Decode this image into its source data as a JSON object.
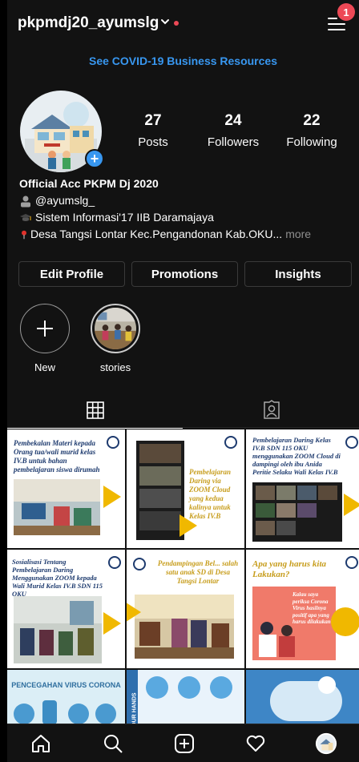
{
  "header": {
    "username": "pkpmdj20_ayumslg",
    "notification_count": "1"
  },
  "banner": {
    "covid_link": "See COVID-19 Business Resources"
  },
  "profile": {
    "stats": [
      {
        "value": "27",
        "label": "Posts"
      },
      {
        "value": "24",
        "label": "Followers"
      },
      {
        "value": "22",
        "label": "Following"
      }
    ],
    "bio": {
      "name": "Official Acc PKPM Dj 2020",
      "handle": "@ayumslg_",
      "line2": "Sistem Informasi'17 IIB Daramajaya",
      "line3": "Desa Tangsi Lontar Kec.Pengandonan Kab.OKU...",
      "more": "more"
    }
  },
  "actions": {
    "edit_profile": "Edit Profile",
    "promotions": "Promotions",
    "insights": "Insights"
  },
  "highlights": [
    {
      "label": "New"
    },
    {
      "label": "stories"
    }
  ],
  "posts": [
    {
      "caption": "Pembekalan Materi kepada Orang tua/wali murid kelas IV.B untuk bahan pembelajaran siswa dirumah"
    },
    {
      "caption": "Pembelajaran Daring via ZOOM Cloud yang kedua kalinya untuk Kelas IV.B"
    },
    {
      "caption": "Pembelajaran Daring Kelas IV.B SDN 115 OKU menggunakan ZOOM Cloud di dampingi oleh ibu Anida Peritie Selaku Wali Kelas IV.B"
    },
    {
      "caption": "Sosialisasi Tentang Pembelajaran Daring Menggunakan ZOOM kepada Wali Murid Kelas IV.B SDN 115 OKU"
    },
    {
      "caption": "Pendampingan Bel... salah satu anak SD di Desa Tangsi Lontar"
    },
    {
      "caption": "Apa yang harus kita Lakukan?"
    },
    {
      "caption": "PENCEGAHAN VIRUS CORONA"
    },
    {
      "caption": "YOUR HANDS"
    },
    {
      "caption": ""
    }
  ],
  "post6_subtext": "Kalau saya periksa Corona Virus hasilnya positif apa yang harus dilakukan?",
  "colors": {
    "background": "#121212",
    "link": "#3897f0",
    "badge": "#ed4956",
    "accent_yellow": "#f0b800"
  }
}
